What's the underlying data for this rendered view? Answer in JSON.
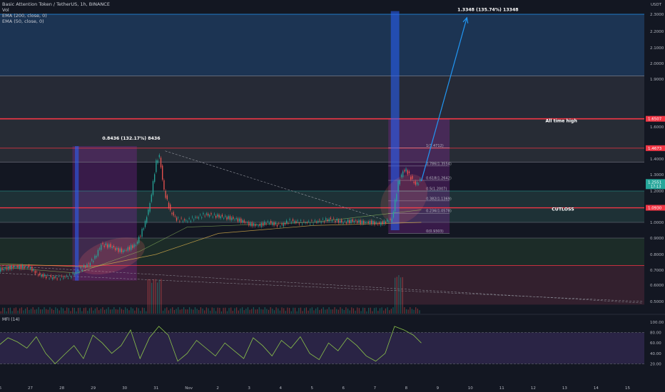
{
  "legend": {
    "symbol_line": "Basic Attention Token / TetherUS, 1h, BINANCE",
    "vol": "Vol",
    "ema200": "EMA (200, close, 0)",
    "ema50": "EMA (50, close, 0)"
  },
  "price_axis_unit": "USDT",
  "mfi_title": "MFI (14)",
  "colors": {
    "background": "#131722",
    "candle_up": "#26a69a",
    "candle_down": "#ef5350",
    "red_line": "#f23645",
    "blue_bar": "#2962ff",
    "purple_box": "#9c27b0",
    "arrow": "#2196f3",
    "mfi_line": "#8bc34a"
  },
  "chart_data": {
    "type": "line",
    "x_axis": {
      "ticks": [
        "26",
        "27",
        "28",
        "29",
        "30",
        "31",
        "Nov",
        "2",
        "3",
        "4",
        "5",
        "6",
        "7",
        "8",
        "9",
        "10",
        "11",
        "12",
        "13",
        "14",
        "15"
      ]
    },
    "price_axis": {
      "ticks": [
        "2.3000",
        "2.2000",
        "2.1000",
        "2.0000",
        "1.9000",
        "1.6000",
        "1.4000",
        "1.3000",
        "1.2000",
        "1.0000",
        "0.9000",
        "0.8000",
        "0.7000",
        "0.6000",
        "0.5000"
      ],
      "badges": [
        {
          "label": "1.6507",
          "value": 1.6507,
          "color": "#f23645"
        },
        {
          "label": "1.4673",
          "value": 1.4673,
          "color": "#f23645"
        },
        {
          "label": "1.2551",
          "sublabel": "17:13",
          "value": 1.2551,
          "color": "#26a69a"
        },
        {
          "label": "1.0930",
          "value": 1.093,
          "color": "#f23645"
        }
      ]
    },
    "annotations": [
      {
        "text": "0.8436 (132.17%) 8436",
        "x_day": 29.3,
        "price": 1.52
      },
      {
        "text": "1.3348 (135.74%) 13348",
        "x_day": 40.6,
        "price": 2.32
      },
      {
        "text": "All time high",
        "x_day": 43.4,
        "price": 1.63
      },
      {
        "text": "CUTLOSS",
        "x_day": 43.6,
        "price": 1.075
      }
    ],
    "horizontal_levels": [
      {
        "price": 2.3,
        "color": "#2196f3",
        "width": 0.8
      },
      {
        "price": 1.92,
        "color": "#787b86",
        "width": 0.8
      },
      {
        "price": 1.6507,
        "color": "#f23645",
        "width": 1.6
      },
      {
        "price": 1.4673,
        "color": "#f23645",
        "width": 0.8
      },
      {
        "price": 1.38,
        "color": "#787b86",
        "width": 0.6
      },
      {
        "price": 1.2,
        "color": "#26a69a",
        "width": 0.6
      },
      {
        "price": 1.093,
        "color": "#f23645",
        "width": 1.4
      },
      {
        "price": 1.0,
        "color": "#787b86",
        "width": 0.6
      },
      {
        "price": 0.9,
        "color": "#787b86",
        "width": 0.6
      },
      {
        "price": 0.73,
        "color": "#f23645",
        "width": 0.8
      }
    ],
    "zones": [
      {
        "from": 1.92,
        "to": 2.3,
        "color": "#1e3a5c"
      },
      {
        "from": 1.6507,
        "to": 1.92,
        "color": "#2a2e39"
      },
      {
        "from": 1.38,
        "to": 1.6507,
        "color": "#2b3038"
      },
      {
        "from": 1.0,
        "to": 1.2,
        "color": "#21363a"
      },
      {
        "from": 0.73,
        "to": 0.9,
        "color": "#1e3029"
      },
      {
        "from": 0.48,
        "to": 0.73,
        "color": "#3a2230"
      }
    ],
    "fib_levels": [
      {
        "label": "1(1.4712)",
        "price": 1.47
      },
      {
        "label": "0.786(1.3554)",
        "price": 1.355
      },
      {
        "label": "0.618(1.2642)",
        "price": 1.265
      },
      {
        "label": "0.5(1.2007)",
        "price": 1.2
      },
      {
        "label": "0.382(1.1369)",
        "price": 1.137
      },
      {
        "label": "0.236(1.0578)",
        "price": 1.058
      },
      {
        "label": "0(0.9303)",
        "price": 0.93
      }
    ],
    "price_series": {
      "name": "",
      "x": [
        26.0,
        26.5,
        27.0,
        27.3,
        27.7,
        28.0,
        28.3,
        28.6,
        28.9,
        29.1,
        29.3,
        29.6,
        29.8,
        30.0,
        30.2,
        30.4,
        30.55,
        30.7,
        30.85,
        30.95,
        31.05,
        31.15,
        31.3,
        31.5,
        31.7,
        32.0,
        32.3,
        32.6,
        33.0,
        33.3,
        33.6,
        34.0,
        34.3,
        34.6,
        35.0,
        35.3,
        35.6,
        36.0,
        36.3,
        36.6,
        37.0,
        37.3,
        37.6,
        37.9,
        38.1,
        38.3,
        38.55,
        38.75,
        38.9,
        39.0,
        39.15,
        39.3,
        39.45
      ],
      "values": [
        0.7,
        0.72,
        0.72,
        0.67,
        0.65,
        0.65,
        0.66,
        0.7,
        0.74,
        0.78,
        0.86,
        0.85,
        0.83,
        0.82,
        0.84,
        0.86,
        0.92,
        1.0,
        1.12,
        1.25,
        1.38,
        1.42,
        1.2,
        1.07,
        1.02,
        1.01,
        1.03,
        1.05,
        1.04,
        1.03,
        1.02,
        0.99,
        0.98,
        1.0,
        0.98,
        1.01,
        1.0,
        1.0,
        1.01,
        1.02,
        1.0,
        1.01,
        1.0,
        1.0,
        0.99,
        1.0,
        1.02,
        1.25,
        1.32,
        1.33,
        1.28,
        1.24,
        1.26
      ]
    },
    "blue_arrow": {
      "from": [
        39.45,
        1.26
      ],
      "to": [
        40.9,
        2.28
      ]
    },
    "purple_boxes": [
      {
        "x_from": 28.35,
        "x_to": 30.4,
        "price_from": 0.63,
        "price_to": 1.48
      },
      {
        "x_from": 38.4,
        "x_to": 40.35,
        "price_from": 0.93,
        "price_to": 1.65
      }
    ],
    "blue_bars": [
      {
        "x_from": 28.43,
        "x_to": 28.55,
        "price_from": 0.63,
        "price_to": 1.48
      },
      {
        "x_from": 38.48,
        "x_to": 38.75,
        "price_from": 0.95,
        "price_to": 2.32
      }
    ],
    "mfi": {
      "title": "MFI (14)",
      "ticks": [
        "100.00",
        "80.00",
        "60.00",
        "40.00",
        "20.00"
      ],
      "levels": [
        80,
        20
      ],
      "x": [
        26.0,
        26.3,
        26.6,
        26.9,
        27.2,
        27.5,
        27.8,
        28.1,
        28.4,
        28.7,
        29.0,
        29.3,
        29.6,
        29.9,
        30.2,
        30.5,
        30.8,
        31.1,
        31.4,
        31.7,
        32.0,
        32.3,
        32.6,
        32.9,
        33.2,
        33.5,
        33.8,
        34.1,
        34.4,
        34.7,
        35.0,
        35.3,
        35.6,
        35.9,
        36.2,
        36.5,
        36.8,
        37.1,
        37.4,
        37.7,
        38.0,
        38.3,
        38.6,
        38.9,
        39.2,
        39.45
      ],
      "values": [
        55,
        70,
        62,
        50,
        72,
        40,
        20,
        38,
        55,
        30,
        75,
        60,
        40,
        55,
        85,
        30,
        70,
        92,
        75,
        25,
        40,
        65,
        50,
        35,
        60,
        45,
        30,
        70,
        55,
        35,
        65,
        50,
        72,
        40,
        28,
        60,
        45,
        70,
        55,
        35,
        25,
        40,
        92,
        85,
        75,
        60
      ]
    }
  }
}
